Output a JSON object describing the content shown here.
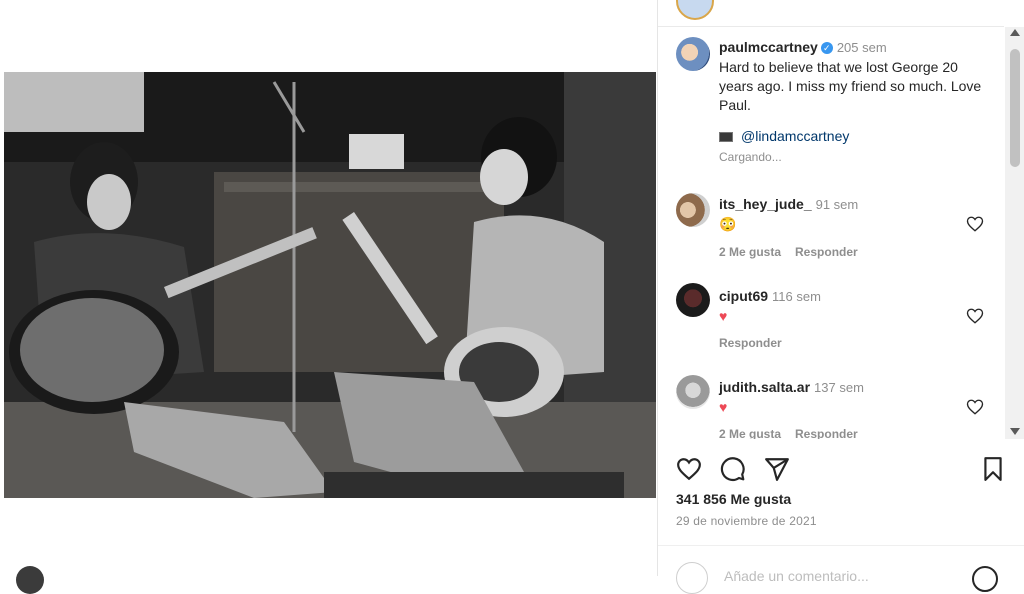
{
  "post": {
    "author": "paulmccartney",
    "time": "205 sem",
    "caption": "Hard to believe that we lost George 20 years ago. I miss my friend so much. Love Paul.",
    "tag": "@lindamccartney",
    "loading": "Cargando..."
  },
  "comments": [
    {
      "user": "its_hey_jude_",
      "time": "91 sem",
      "text": "😳",
      "likes": "2 Me gusta",
      "reply": "Responder"
    },
    {
      "user": "ciput69",
      "time": "116 sem",
      "text": "♥",
      "reply": "Responder"
    },
    {
      "user": "judith.salta.ar",
      "time": "137 sem",
      "text": "♥",
      "likes": "2 Me gusta",
      "reply": "Responder"
    }
  ],
  "footer": {
    "likes": "341 856 Me gusta",
    "date": "29 de noviembre de 2021",
    "add_comment": "Añade un comentario..."
  },
  "icons": [
    "verified-badge-icon",
    "heart-icon",
    "comment-icon",
    "share-icon",
    "bookmark-icon",
    "emoji-icon"
  ]
}
